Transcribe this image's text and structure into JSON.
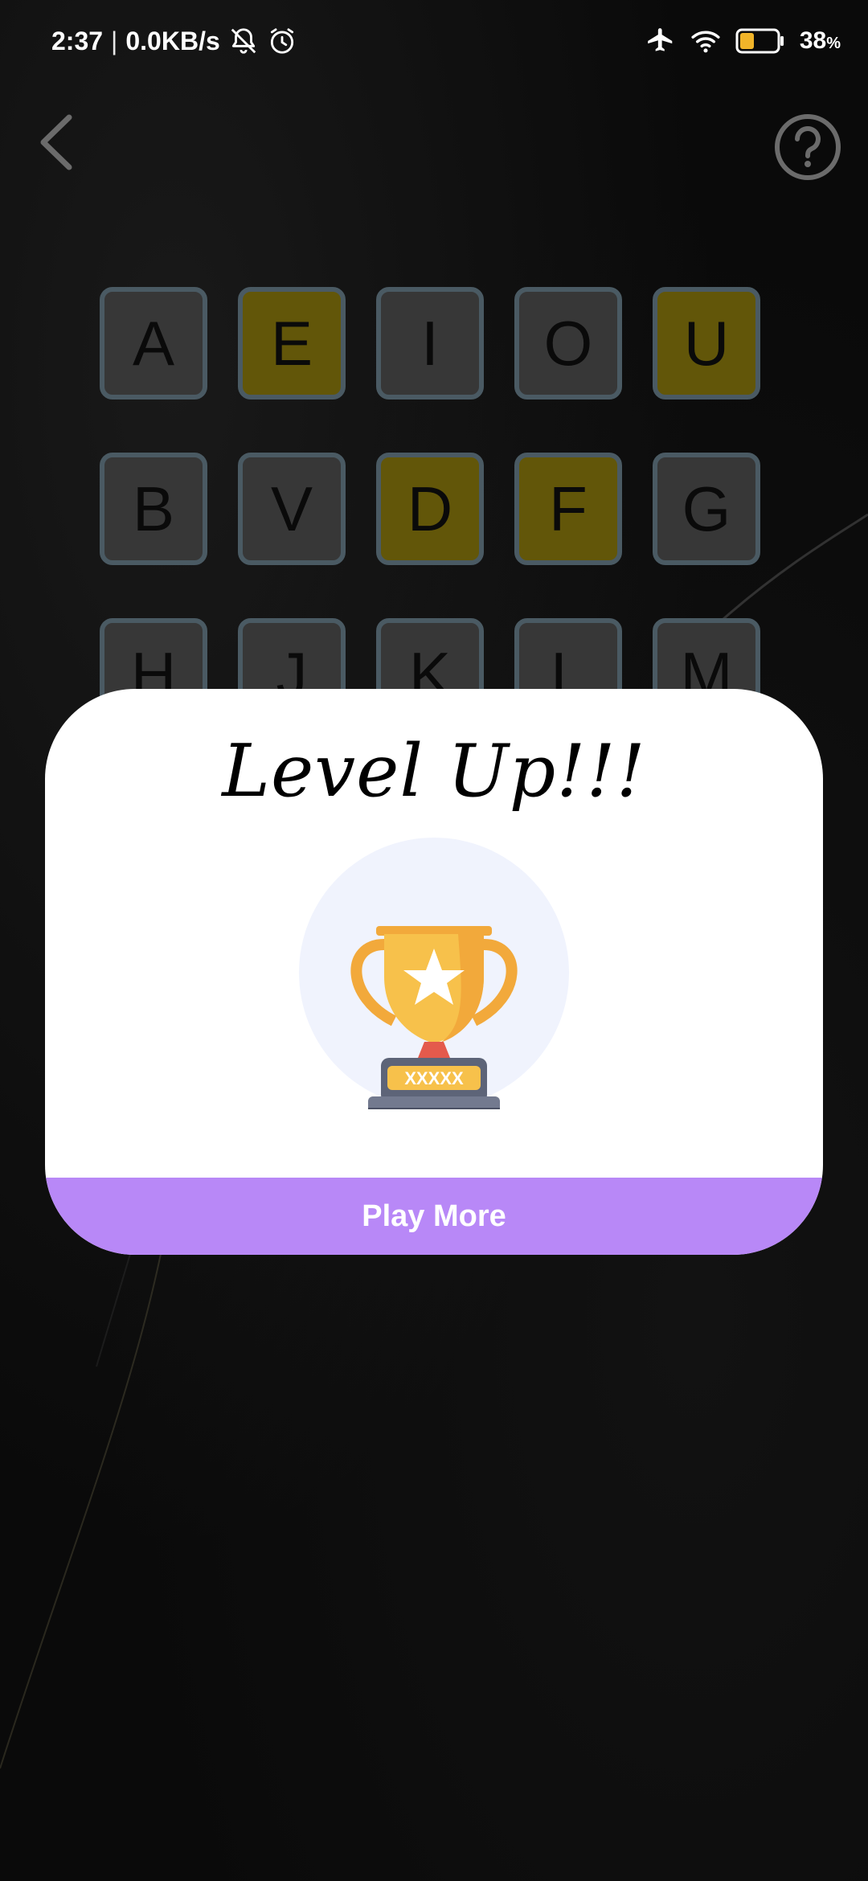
{
  "status_bar": {
    "time": "2:37",
    "separator": "|",
    "net_speed": "0.0KB/s",
    "battery_percent": "38",
    "battery_unit": "%",
    "battery_level": 0.38,
    "battery_fill_color": "#f0b429",
    "icons": [
      "notifications-off-icon",
      "alarm-icon",
      "airplane-mode-icon",
      "wifi-icon",
      "battery-icon"
    ]
  },
  "nav": {
    "back_icon": "chevron-left-icon",
    "help_icon": "help-circle-icon"
  },
  "tiles": {
    "row1": [
      {
        "letter": "A",
        "state": "default"
      },
      {
        "letter": "E",
        "state": "hit"
      },
      {
        "letter": "I",
        "state": "default"
      },
      {
        "letter": "O",
        "state": "default"
      },
      {
        "letter": "U",
        "state": "hit"
      }
    ],
    "row2": [
      {
        "letter": "B",
        "state": "default"
      },
      {
        "letter": "V",
        "state": "default"
      },
      {
        "letter": "D",
        "state": "hit"
      },
      {
        "letter": "F",
        "state": "hit"
      },
      {
        "letter": "G",
        "state": "default"
      }
    ],
    "row3": [
      {
        "letter": "H",
        "state": "default"
      },
      {
        "letter": "J",
        "state": "default"
      },
      {
        "letter": "K",
        "state": "default"
      },
      {
        "letter": "L",
        "state": "default"
      },
      {
        "letter": "M",
        "state": "default"
      }
    ]
  },
  "colors": {
    "tile_default": "#373737",
    "tile_hit": "#625609",
    "tile_border": "#4a5a63",
    "button_accent": "#b888f7",
    "trophy_gold": "#f7c14b",
    "trophy_base": "#5d6478"
  },
  "modal": {
    "title": "Level Up!!!",
    "trophy_icon": "trophy-icon",
    "trophy_plate_text": "XXXXX",
    "button_label": "Play More"
  }
}
